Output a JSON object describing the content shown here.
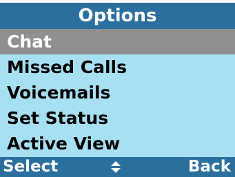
{
  "title": "Options",
  "menu": {
    "items": [
      {
        "label": "Chat",
        "selected": true
      },
      {
        "label": "Missed Calls",
        "selected": false
      },
      {
        "label": "Voicemails",
        "selected": false
      },
      {
        "label": "Set Status",
        "selected": false
      },
      {
        "label": "Active View",
        "selected": false
      }
    ]
  },
  "softkeys": {
    "left_label": "Select",
    "right_label": "Back",
    "center_icon": "up-down-arrows-icon"
  },
  "colors": {
    "header_bg": "#2b6f9f",
    "menu_bg": "#a7e0f2",
    "selected_bg": "#8f8f8f",
    "text_light": "#ffffff",
    "text_dark": "#000000"
  }
}
